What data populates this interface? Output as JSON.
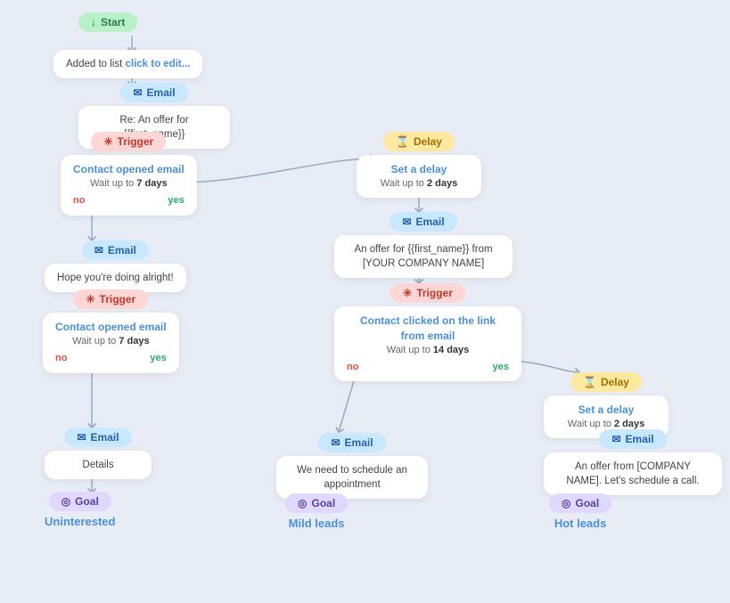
{
  "nodes": {
    "start": {
      "label": "Start",
      "icon": "↓"
    },
    "addedToList": {
      "label": "Added to list  click to edit..."
    },
    "email1_pill": {
      "label": "Email"
    },
    "email1_card": {
      "label": "Re: An offer for {{first_name}}"
    },
    "trigger1_pill": {
      "label": "Trigger"
    },
    "trigger1_card_link": "Contact opened email",
    "trigger1_wait": "Wait up to",
    "trigger1_days": "7",
    "trigger1_days_unit": "days",
    "trigger1_no": "no",
    "trigger1_yes": "yes",
    "email2_pill": {
      "label": "Email"
    },
    "email2_card": {
      "label": "Hope you're doing alright!"
    },
    "trigger2_pill": {
      "label": "Trigger"
    },
    "trigger2_card_link": "Contact opened email",
    "trigger2_wait": "Wait up to",
    "trigger2_days": "7",
    "trigger2_days_unit": "days",
    "trigger2_no": "no",
    "trigger2_yes": "yes",
    "email3_pill": {
      "label": "Email"
    },
    "email3_card": {
      "label": "Details"
    },
    "goal1_pill": {
      "label": "Goal"
    },
    "goal1_label": "Uninterested",
    "delay1_pill": {
      "label": "Delay"
    },
    "delay1_card_link": "Set a delay",
    "delay1_wait": "Wait up to",
    "delay1_days": "2",
    "delay1_days_unit": "days",
    "email4_pill": {
      "label": "Email"
    },
    "email4_card": {
      "label": "An offer for {{first_name}} from [YOUR COMPANY NAME]"
    },
    "trigger3_pill": {
      "label": "Trigger"
    },
    "trigger3_card_link": "Contact clicked on the link from email",
    "trigger3_wait": "Wait up to",
    "trigger3_days": "14",
    "trigger3_days_unit": "days",
    "trigger3_no": "no",
    "trigger3_yes": "yes",
    "email5_pill": {
      "label": "Email"
    },
    "email5_card": {
      "label": "We need to schedule an appointment"
    },
    "goal2_pill": {
      "label": "Goal"
    },
    "goal2_label": "Mild leads",
    "delay2_pill": {
      "label": "Delay"
    },
    "delay2_card_link": "Set a delay",
    "delay2_wait": "Wait up to",
    "delay2_days": "2",
    "delay2_days_unit": "days",
    "email6_pill": {
      "label": "Email"
    },
    "email6_card": {
      "label": "An offer from [COMPANY NAME]. Let's schedule a call."
    },
    "goal3_pill": {
      "label": "Goal"
    },
    "goal3_label": "Hot leads"
  },
  "colors": {
    "start_bg": "#b8f0c8",
    "start_fg": "#2d7a4f",
    "email_bg": "#c8e8ff",
    "email_fg": "#2563a8",
    "trigger_bg": "#ffd6d6",
    "trigger_fg": "#c0392b",
    "delay_bg": "#ffe8a0",
    "delay_fg": "#a07000",
    "goal_bg": "#e0d8ff",
    "goal_fg": "#5b3fa0",
    "no_color": "#e74c3c",
    "yes_color": "#27ae60",
    "link_color": "#4a90d9",
    "arrow_color": "#9aa8c0"
  }
}
